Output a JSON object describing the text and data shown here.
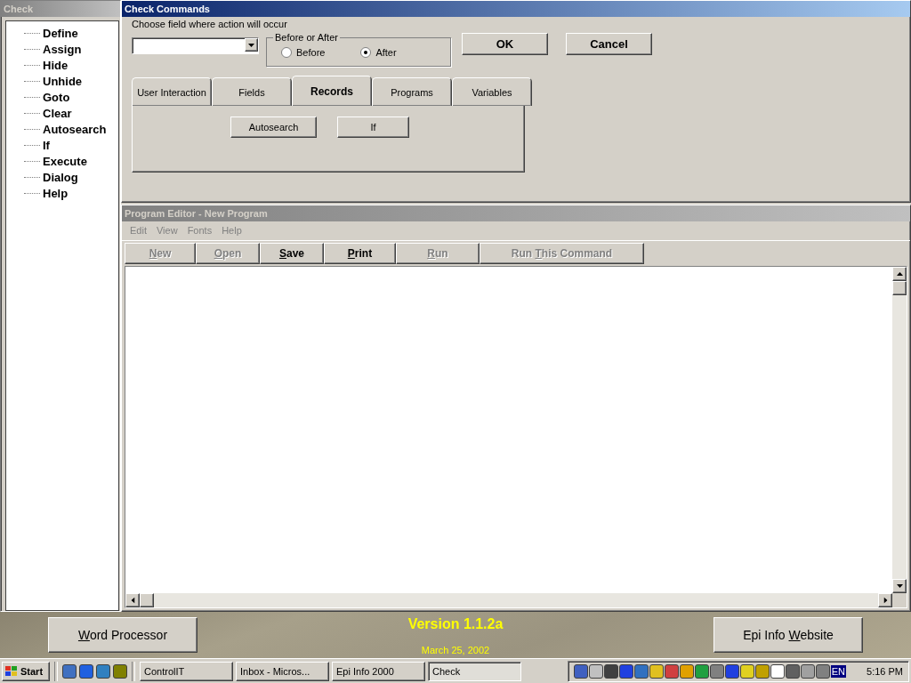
{
  "check_panel": {
    "title": "Check",
    "items": [
      "Define",
      "Assign",
      "Hide",
      "Unhide",
      "Goto",
      "Clear",
      "Autosearch",
      "If",
      "Execute",
      "Dialog",
      "Help"
    ]
  },
  "check_commands": {
    "title": "Check Commands",
    "field_label": "Choose field where action will occur",
    "timing": {
      "legend": "Before or After",
      "options": [
        {
          "label": "Before",
          "selected": false
        },
        {
          "label": "After",
          "selected": true
        }
      ]
    },
    "buttons": [
      "OK",
      "Cancel"
    ],
    "tabs": [
      {
        "label": "User Interaction",
        "selected": false
      },
      {
        "label": "Fields",
        "selected": false
      },
      {
        "label": "Records",
        "selected": true
      },
      {
        "label": "Programs",
        "selected": false
      },
      {
        "label": "Variables",
        "selected": false
      }
    ],
    "tab_buttons": [
      "Autosearch",
      "If"
    ]
  },
  "program_editor": {
    "title": "Program Editor - New Program",
    "menu": [
      "Edit",
      "View",
      "Fonts",
      "Help"
    ],
    "toolbar": [
      {
        "key": "N",
        "after": "ew",
        "disabled": true
      },
      {
        "key": "O",
        "after": "pen",
        "disabled": true
      },
      {
        "key": "S",
        "after": "ave",
        "disabled": false
      },
      {
        "key": "P",
        "after": "rint",
        "disabled": false
      },
      {
        "key": "R",
        "after": "un",
        "disabled": true
      },
      {
        "before": "Run ",
        "key": "T",
        "after": "his Command",
        "disabled": true
      }
    ]
  },
  "banner": {
    "left_button": {
      "key": "W",
      "after": "ord Processor"
    },
    "version": "Version 1.1.2a",
    "date": "March 25, 2002",
    "right_button": {
      "before": "Epi Info ",
      "key": "W",
      "after": "ebsite"
    }
  },
  "taskbar": {
    "start": "Start",
    "tasks": [
      {
        "label": "ControlIT",
        "selected": false
      },
      {
        "label": "Inbox - Micros...",
        "selected": false
      },
      {
        "label": "Epi Info 2000",
        "selected": false
      },
      {
        "label": "Check",
        "selected": true
      }
    ],
    "tray_language": "EN",
    "clock": "5:16 PM"
  }
}
